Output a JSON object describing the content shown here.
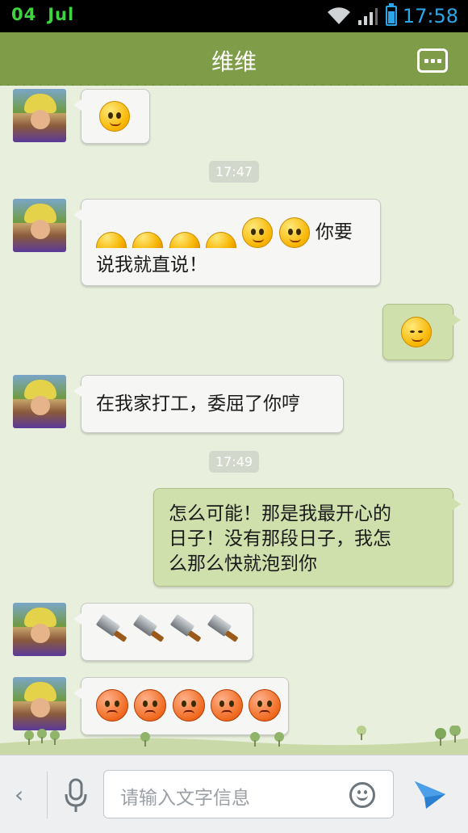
{
  "status": {
    "day": "04",
    "month": "Jul",
    "time": "17:58",
    "accent_color": "#2ba6e8"
  },
  "header": {
    "title": "维维",
    "menu_icon": "more-dots-icon"
  },
  "messages": [
    {
      "side": "left",
      "kind": "emoji",
      "emoji": "sweat-face"
    },
    {
      "timestamp": "17:47"
    },
    {
      "side": "left",
      "kind": "text",
      "emojis_prefix": [
        "smile",
        "smile",
        "smile",
        "smile",
        "tongue",
        "tongue"
      ],
      "text_inline": "你要",
      "text": "说我就直说！"
    },
    {
      "side": "right",
      "kind": "emoji",
      "emoji": "content-smile"
    },
    {
      "side": "left",
      "kind": "text",
      "text": "在我家打工，委屈了你哼"
    },
    {
      "timestamp": "17:49"
    },
    {
      "side": "right",
      "kind": "text",
      "text_lines": [
        "怎么可能！那是我最开心的",
        "日子！没有那段日子，我怎",
        "么那么快就泡到你"
      ]
    },
    {
      "side": "left",
      "kind": "emoji",
      "emoji": "kitchen-knife",
      "count": 4
    },
    {
      "side": "left",
      "kind": "emoji",
      "emoji": "angry-fire-face",
      "count": 5
    }
  ],
  "input": {
    "placeholder": "请输入文字信息"
  },
  "colors": {
    "title_bar": "#7f9c49",
    "chat_bg": "#e8efdc",
    "my_bubble": "#cfe0ad",
    "their_bubble": "#f6f6f4"
  }
}
